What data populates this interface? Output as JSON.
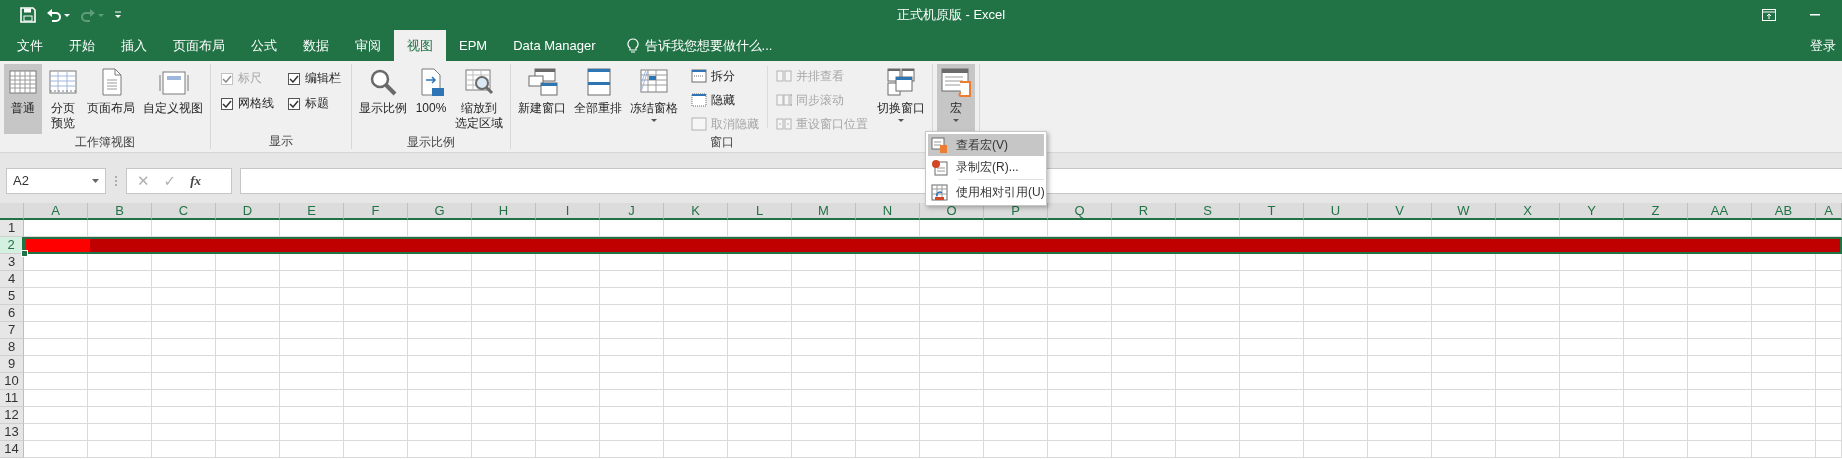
{
  "window": {
    "title": "正式机原版 - Excel"
  },
  "quick_access": [
    {
      "kind": "save",
      "disabled": false
    },
    {
      "kind": "undo",
      "disabled": false
    },
    {
      "kind": "redo",
      "disabled": true
    },
    {
      "kind": "customize",
      "disabled": false
    }
  ],
  "tabs": [
    {
      "label": "文件",
      "selected": false
    },
    {
      "label": "开始",
      "selected": false
    },
    {
      "label": "插入",
      "selected": false
    },
    {
      "label": "页面布局",
      "selected": false
    },
    {
      "label": "公式",
      "selected": false
    },
    {
      "label": "数据",
      "selected": false
    },
    {
      "label": "审阅",
      "selected": false
    },
    {
      "label": "视图",
      "selected": true
    },
    {
      "label": "EPM",
      "selected": false
    },
    {
      "label": "Data Manager",
      "selected": false
    }
  ],
  "tell_me": {
    "label": "告诉我您想要做什么..."
  },
  "sign_in": "登录",
  "ribbon": {
    "groups": [
      {
        "label": "工作簿视图",
        "items": [
          {
            "kind": "large",
            "label": "普通",
            "selected": true
          },
          {
            "kind": "large",
            "lines": [
              "分页",
              "预览"
            ],
            "selected": false
          },
          {
            "kind": "large",
            "label": "页面布局",
            "selected": false
          },
          {
            "kind": "large",
            "label": "自定义视图",
            "selected": false
          }
        ]
      },
      {
        "label": "显示",
        "items": [
          {
            "kind": "check",
            "label": "标尺",
            "checked": true,
            "disabled": true
          },
          {
            "kind": "check",
            "label": "编辑栏",
            "checked": true,
            "disabled": false
          },
          {
            "kind": "check",
            "label": "网格线",
            "checked": true,
            "disabled": false
          },
          {
            "kind": "check",
            "label": "标题",
            "checked": true,
            "disabled": false
          }
        ]
      },
      {
        "label": "显示比例",
        "items": [
          {
            "kind": "large",
            "label": "显示比例",
            "selected": false
          },
          {
            "kind": "large",
            "label": "100%",
            "selected": false
          },
          {
            "kind": "large",
            "lines": [
              "缩放到",
              "选定区域"
            ],
            "selected": false
          }
        ]
      },
      {
        "label": "窗口",
        "items": [
          {
            "kind": "large",
            "label": "新建窗口",
            "selected": false
          },
          {
            "kind": "large",
            "label": "全部重排",
            "selected": false
          },
          {
            "kind": "large",
            "label": "冻结窗格",
            "selected": false,
            "dropdown": true
          },
          {
            "kind": "small",
            "label": "拆分",
            "disabled": false
          },
          {
            "kind": "small",
            "label": "隐藏",
            "disabled": false
          },
          {
            "kind": "small",
            "label": "取消隐藏",
            "disabled": true
          },
          {
            "kind": "small",
            "label": "并排查看",
            "disabled": true
          },
          {
            "kind": "small",
            "label": "同步滚动",
            "disabled": true
          },
          {
            "kind": "small",
            "label": "重设窗口位置",
            "disabled": true
          },
          {
            "kind": "large",
            "label": "切换窗口",
            "selected": false,
            "dropdown": true
          }
        ]
      },
      {
        "items": [
          {
            "kind": "large",
            "label": "宏",
            "selected": true,
            "dropdown": true
          }
        ]
      }
    ]
  },
  "macro_menu": {
    "items": [
      {
        "label": "查看宏(V)",
        "selected": true,
        "divider_before": false
      },
      {
        "label": "录制宏(R)...",
        "selected": false,
        "divider_before": false
      },
      {
        "label": "使用相对引用(U)",
        "selected": false,
        "divider_before": true
      }
    ]
  },
  "formula_bar": {
    "name_box": "A2",
    "cancel": "✕",
    "enter": "✓",
    "function": "fx"
  },
  "sheet": {
    "columns": [
      "A",
      "B",
      "C",
      "D",
      "E",
      "F",
      "G",
      "H",
      "I",
      "J",
      "K",
      "L",
      "M",
      "N",
      "O",
      "P",
      "Q",
      "R",
      "S",
      "T",
      "U",
      "V",
      "W",
      "X",
      "Y",
      "Z",
      "AA",
      "AB",
      "A"
    ],
    "rows": [
      {
        "header": "1",
        "selected": false
      },
      {
        "header": "2",
        "selected": true,
        "cells": [
          {
            "color": "#ff0000"
          },
          {
            "color": "#c00000"
          },
          {
            "color": "#c00000"
          },
          {
            "color": "#c00000"
          },
          {
            "color": "#c00000"
          },
          {
            "color": "#c00000"
          },
          {
            "color": "#c00000"
          },
          {
            "color": "#c00000"
          },
          {
            "color": "#c00000"
          },
          {
            "color": "#c00000"
          },
          {
            "color": "#c00000"
          },
          {
            "color": "#c00000"
          },
          {
            "color": "#c00000"
          },
          {
            "color": "#c00000"
          },
          {
            "color": "#c00000"
          },
          {
            "color": "#c00000"
          },
          {
            "color": "#c00000"
          },
          {
            "color": "#c00000"
          },
          {
            "color": "#c00000"
          },
          {
            "color": "#c00000"
          },
          {
            "color": "#c00000"
          },
          {
            "color": "#c00000"
          },
          {
            "color": "#c00000"
          },
          {
            "color": "#c00000"
          },
          {
            "color": "#c00000"
          },
          {
            "color": "#c00000"
          },
          {
            "color": "#c00000"
          },
          {
            "color": "#c00000"
          },
          {
            "color": "#c00000"
          }
        ]
      },
      {
        "header": "3",
        "selected": false
      },
      {
        "header": "4",
        "selected": false
      },
      {
        "header": "5",
        "selected": false
      },
      {
        "header": "6",
        "selected": false
      },
      {
        "header": "7",
        "selected": false
      },
      {
        "header": "8",
        "selected": false
      },
      {
        "header": "9",
        "selected": false
      },
      {
        "header": "10",
        "selected": false
      },
      {
        "header": "11",
        "selected": false
      },
      {
        "header": "12",
        "selected": false
      },
      {
        "header": "13",
        "selected": false
      },
      {
        "header": "14",
        "selected": false
      }
    ]
  }
}
